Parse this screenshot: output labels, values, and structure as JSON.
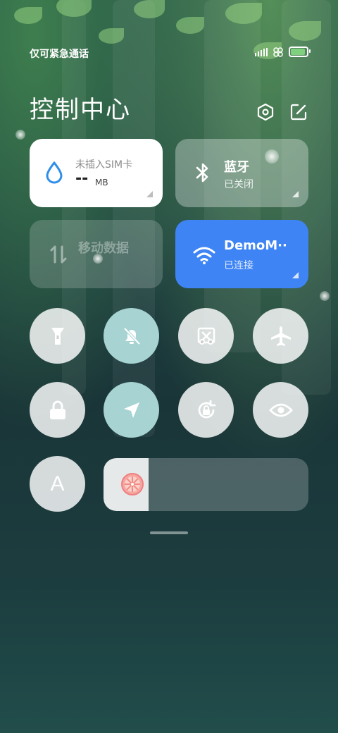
{
  "status": {
    "carrier": "仅可紧急通话"
  },
  "header": {
    "title": "控制中心",
    "settings_icon": "gear-hex-icon",
    "edit_icon": "edit-icon"
  },
  "cards": {
    "data_usage": {
      "label": "未插入SIM卡",
      "value": "--",
      "unit": "MB"
    },
    "bluetooth": {
      "title": "蓝牙",
      "status": "已关闭"
    },
    "mobile_data": {
      "title": "移动数据",
      "status": ""
    },
    "wifi": {
      "title": "DemoM··",
      "status": "已连接"
    }
  },
  "toggles": [
    {
      "name": "flashlight",
      "active": false
    },
    {
      "name": "mute",
      "active": true
    },
    {
      "name": "screenshot",
      "active": false
    },
    {
      "name": "airplane-mode",
      "active": false
    },
    {
      "name": "lock-screen",
      "active": false
    },
    {
      "name": "location",
      "active": true
    },
    {
      "name": "auto-rotate",
      "active": false
    },
    {
      "name": "reading-mode",
      "active": false
    },
    {
      "name": "auto-brightness",
      "active": false,
      "label": "A"
    }
  ],
  "brightness": {
    "level": 0.22
  },
  "colors": {
    "accent": "#3e84f5",
    "active_toggle": "#a7d3d3"
  }
}
